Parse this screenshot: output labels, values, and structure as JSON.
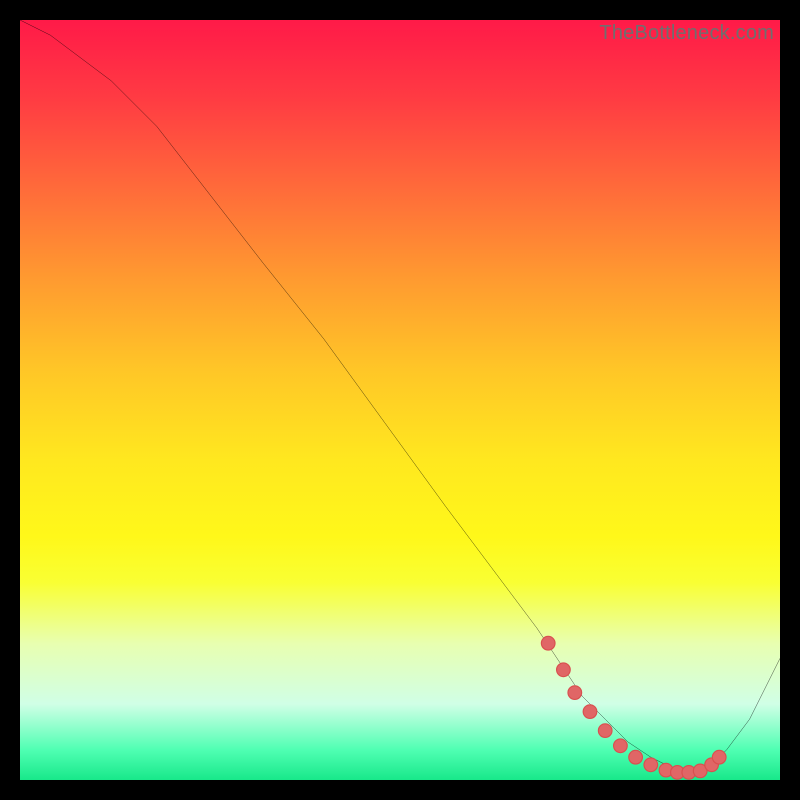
{
  "watermark": "TheBottleneck.com",
  "colors": {
    "curve_stroke": "#000000",
    "marker_fill": "#e06666",
    "marker_stroke": "#d94f4f"
  },
  "chart_data": {
    "type": "line",
    "title": "",
    "xlabel": "",
    "ylabel": "",
    "xlim": [
      0,
      100
    ],
    "ylim": [
      0,
      100
    ],
    "curve": {
      "x": [
        0,
        4,
        8,
        12,
        18,
        25,
        32,
        40,
        48,
        56,
        62,
        68,
        72,
        74,
        77,
        80,
        83,
        85,
        87,
        89,
        91,
        93,
        96,
        100
      ],
      "y": [
        100,
        98,
        95,
        92,
        86,
        77,
        68,
        58,
        47,
        36,
        28,
        20,
        14,
        11,
        8,
        5,
        3,
        2,
        1,
        1,
        2,
        4,
        8,
        16
      ]
    },
    "markers": {
      "x": [
        69.5,
        71.5,
        73.0,
        75.0,
        77.0,
        79.0,
        81.0,
        83.0,
        85.0,
        86.5,
        88.0,
        89.5,
        91.0,
        92.0
      ],
      "y": [
        18.0,
        14.5,
        11.5,
        9.0,
        6.5,
        4.5,
        3.0,
        2.0,
        1.3,
        1.0,
        1.0,
        1.2,
        2.0,
        3.0
      ]
    }
  }
}
